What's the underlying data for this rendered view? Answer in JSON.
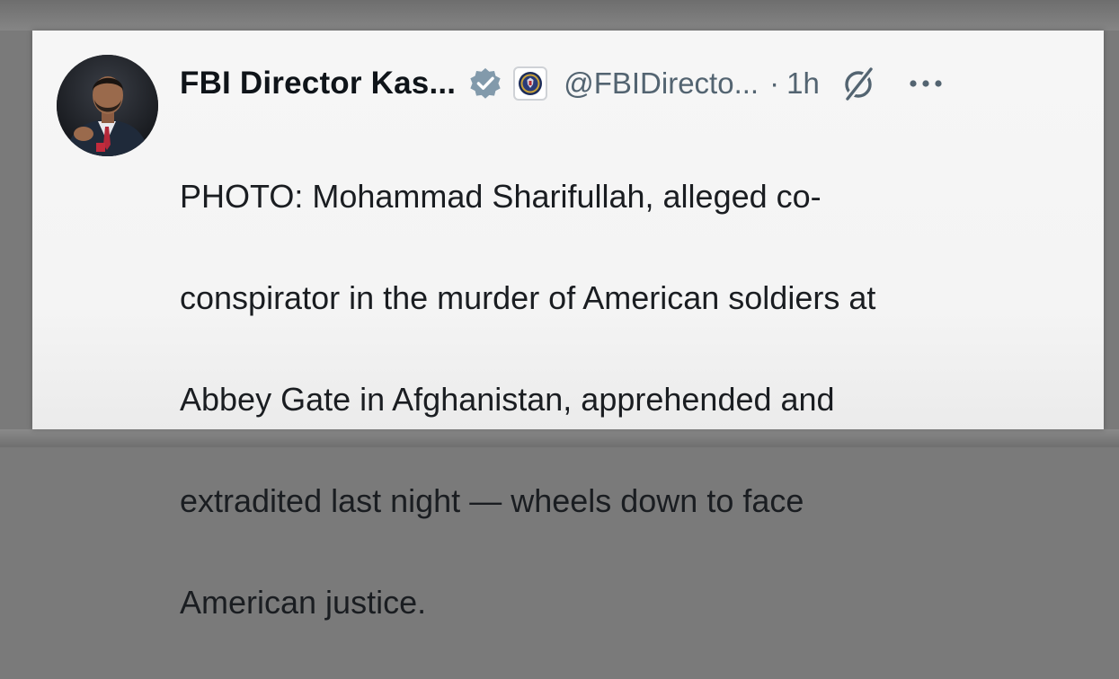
{
  "post": {
    "author_name": "FBI Director Kas...",
    "handle": "@FBIDirecto...",
    "separator": "·",
    "time": "1h",
    "text_lines": [
      "PHOTO: Mohammad Sharifullah, alleged co-",
      "conspirator in the murder of American soldiers at",
      "Abbey Gate in Afghanistan, apprehended and",
      "extradited last night — wheels down to face",
      "American justice."
    ]
  },
  "icons": {
    "verified": "verified-badge-icon",
    "affiliation": "fbi-seal-icon",
    "grok": "grok-icon",
    "more": "more-options-icon"
  },
  "colors": {
    "verified_badge": "#829aab",
    "secondary_text": "#536471",
    "primary_text": "#0f1419"
  }
}
